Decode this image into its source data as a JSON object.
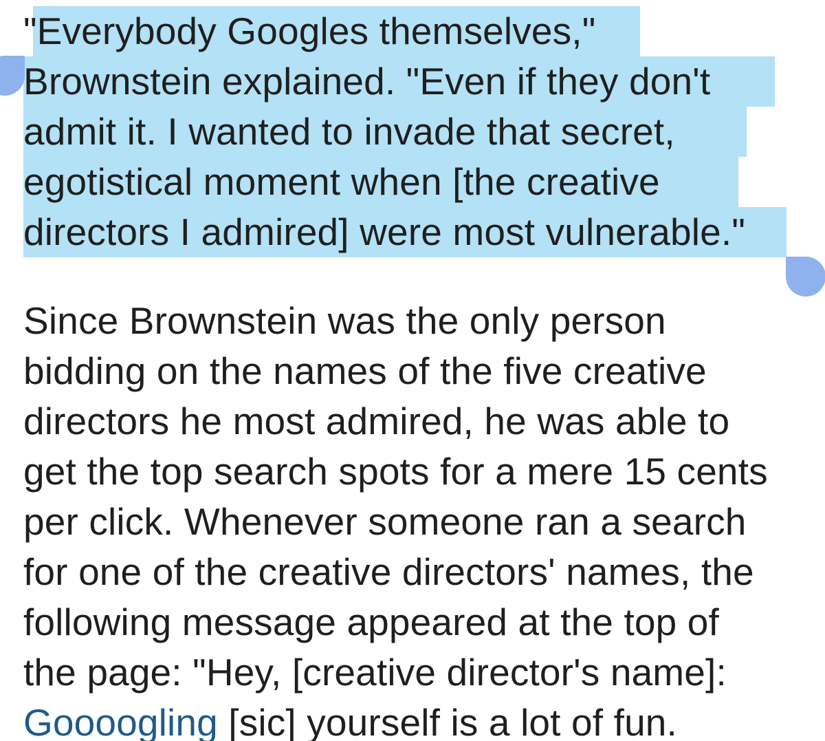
{
  "article": {
    "selected_paragraph": [
      "\"Everybody Googles themselves,\"",
      "Brownstein explained. \"Even if they don't",
      "admit it. I wanted to invade that secret,",
      "egotistical moment when [the creative",
      "directors I admired] were most vulnerable.\""
    ],
    "body_paragraph": [
      "Since Brownstein was the only person",
      "bidding on the names of the five creative",
      "directors he most admired, he was able to",
      "get the top search spots for a mere 15 cents",
      "per click. Whenever someone ran a search",
      "for one of the creative directors' names, the",
      "following message appeared at the top of",
      "the page: \"Hey, [creative director's name]:"
    ],
    "last_line": {
      "link_text": "Goooogling",
      "rest_text": " [sic] yourself is a lot of fun."
    }
  },
  "selection": {
    "highlight_color": "#b3e1f5",
    "handle_color": "#8fb1ee",
    "link_color": "#1f5b8a"
  }
}
